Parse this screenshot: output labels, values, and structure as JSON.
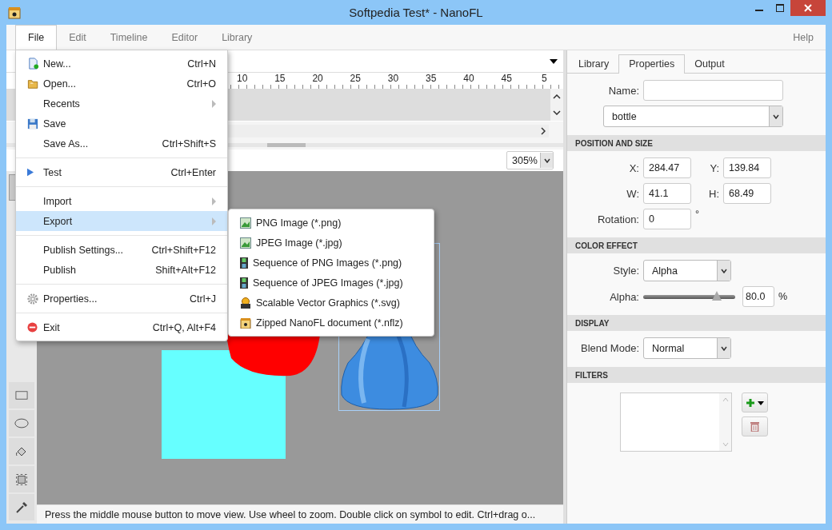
{
  "window": {
    "title": "Softpedia Test* - NanoFL"
  },
  "menubar": {
    "items": [
      {
        "label": "File",
        "selected": true
      },
      {
        "label": "Edit",
        "selected": false
      },
      {
        "label": "Timeline",
        "selected": false
      },
      {
        "label": "Editor",
        "selected": false
      },
      {
        "label": "Library",
        "selected": false
      }
    ],
    "help": "Help"
  },
  "timeline": {
    "ruler": [
      "10",
      "15",
      "20",
      "25",
      "30",
      "35",
      "40",
      "45",
      "5"
    ]
  },
  "zoom": {
    "value": "305%"
  },
  "file_menu": {
    "groups": [
      [
        {
          "label": "New...",
          "shortcut": "Ctrl+N",
          "has_submenu": false,
          "selected": false
        },
        {
          "label": "Open...",
          "shortcut": "Ctrl+O",
          "has_submenu": false,
          "selected": false
        },
        {
          "label": "Recents",
          "has_submenu": true,
          "selected": false
        },
        {
          "label": "Save",
          "has_submenu": false,
          "selected": false
        },
        {
          "label": "Save As...",
          "shortcut": "Ctrl+Shift+S",
          "has_submenu": false,
          "selected": false
        }
      ],
      [
        {
          "label": "Test",
          "shortcut": "Ctrl+Enter",
          "has_submenu": false,
          "selected": false
        }
      ],
      [
        {
          "label": "Import",
          "has_submenu": true,
          "selected": false
        },
        {
          "label": "Export",
          "has_submenu": true,
          "selected": true
        }
      ],
      [
        {
          "label": "Publish Settings...",
          "shortcut": "Ctrl+Shift+F12",
          "has_submenu": false,
          "selected": false
        },
        {
          "label": "Publish",
          "shortcut": "Shift+Alt+F12",
          "has_submenu": false,
          "selected": false
        }
      ],
      [
        {
          "label": "Properties...",
          "shortcut": "Ctrl+J",
          "has_submenu": false,
          "selected": false
        }
      ],
      [
        {
          "label": "Exit",
          "shortcut": "Ctrl+Q, Alt+F4",
          "has_submenu": false,
          "selected": false
        }
      ]
    ]
  },
  "export_menu": {
    "items": [
      {
        "label": "PNG Image (*.png)"
      },
      {
        "label": "JPEG Image (*.jpg)"
      },
      {
        "label": "Sequence of PNG Images (*.png)"
      },
      {
        "label": "Sequence of JPEG Images (*.jpg)"
      },
      {
        "label": "Scalable Vector Graphics (*.svg)"
      },
      {
        "label": "Zipped NanoFL document (*.nflz)"
      }
    ]
  },
  "status_bar": {
    "text": "Press the middle mouse button to move view. Use wheel to zoom. Double click on symbol to edit. Ctrl+drag o..."
  },
  "panel": {
    "tabs": [
      {
        "label": "Library",
        "selected": false
      },
      {
        "label": "Properties",
        "selected": true
      },
      {
        "label": "Output",
        "selected": false
      }
    ],
    "name_label": "Name:",
    "symbol": "bottle",
    "sections": {
      "position": "POSITION AND SIZE",
      "color_effect": "COLOR EFFECT",
      "display": "DISPLAY",
      "filters": "FILTERS"
    },
    "x": {
      "label": "X:",
      "value": "284.47"
    },
    "y": {
      "label": "Y:",
      "value": "139.84"
    },
    "w": {
      "label": "W:",
      "value": "41.1"
    },
    "h": {
      "label": "H:",
      "value": "68.49"
    },
    "rotation": {
      "label": "Rotation:",
      "value": "0",
      "unit": "°"
    },
    "style": {
      "label": "Style:",
      "value": "Alpha"
    },
    "alpha": {
      "label": "Alpha:",
      "level": 0.8,
      "value": "80.0",
      "unit": "%"
    },
    "blend": {
      "label": "Blend Mode:",
      "value": "Normal"
    }
  }
}
